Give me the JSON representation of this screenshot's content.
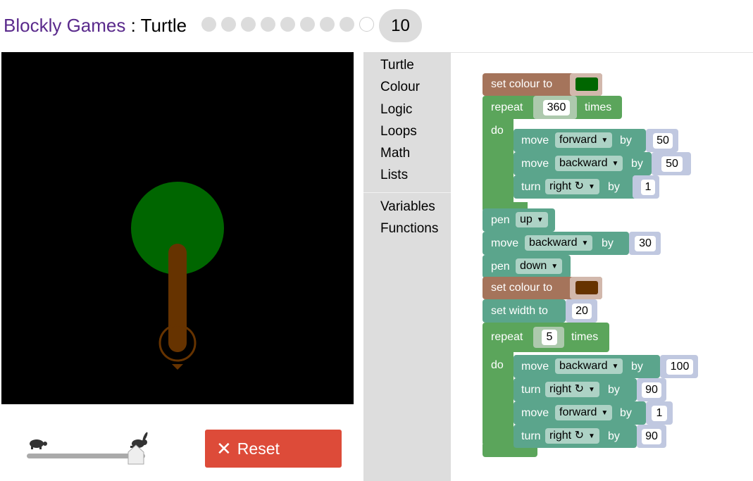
{
  "header": {
    "brand": "Blockly Games",
    "separator": " : ",
    "game": "Turtle",
    "current_level": "10",
    "total_dots": 9
  },
  "colors": {
    "brand": "#5a2a8c",
    "reset_button": "#dd4b39",
    "motion_block": "#5ba58c",
    "loop_block": "#5ba55b",
    "colour_block": "#a5745b",
    "toolbox_bg": "#dddddd",
    "tree_leaves": "#006600",
    "tree_trunk": "#663300"
  },
  "toolbox": {
    "items": [
      "Turtle",
      "Colour",
      "Logic",
      "Loops",
      "Math",
      "Lists",
      "Variables",
      "Functions"
    ]
  },
  "controls": {
    "reset_label": "Reset",
    "speed_slow_icon": "turtle-icon",
    "speed_fast_icon": "rabbit-icon",
    "speed_value": 1.0
  },
  "program": {
    "set_colour_1": {
      "label": "set colour to",
      "colour": "#006600"
    },
    "repeat_1": {
      "label": "repeat",
      "times_label": "times",
      "count": "360",
      "do_label": "do"
    },
    "move_1": {
      "label": "move",
      "direction": "forward",
      "by_label": "by",
      "value": "50"
    },
    "move_2": {
      "label": "move",
      "direction": "backward",
      "by_label": "by",
      "value": "50"
    },
    "turn_1": {
      "label": "turn",
      "direction": "right ↻",
      "by_label": "by",
      "value": "1"
    },
    "pen_1": {
      "label": "pen",
      "state": "up"
    },
    "move_3": {
      "label": "move",
      "direction": "backward",
      "by_label": "by",
      "value": "30"
    },
    "pen_2": {
      "label": "pen",
      "state": "down"
    },
    "set_colour_2": {
      "label": "set colour to",
      "colour": "#663300"
    },
    "set_width": {
      "label": "set width to",
      "value": "20"
    },
    "repeat_2": {
      "label": "repeat",
      "times_label": "times",
      "count": "5",
      "do_label": "do"
    },
    "move_4": {
      "label": "move",
      "direction": "backward",
      "by_label": "by",
      "value": "100"
    },
    "turn_2": {
      "label": "turn",
      "direction": "right ↻",
      "by_label": "by",
      "value": "90"
    },
    "move_5": {
      "label": "move",
      "direction": "forward",
      "by_label": "by",
      "value": "1"
    },
    "turn_3": {
      "label": "turn",
      "direction": "right ↻",
      "by_label": "by",
      "value": "90"
    }
  }
}
